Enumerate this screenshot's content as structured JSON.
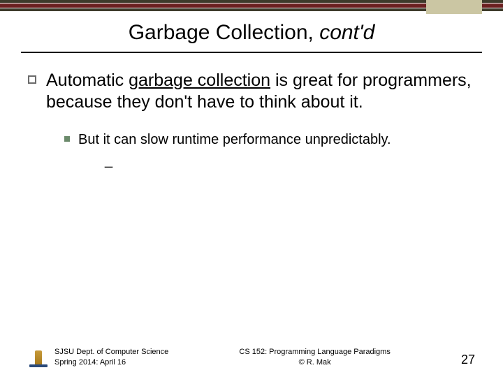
{
  "title_plain": "Garbage Collection, ",
  "title_italic": "cont'd",
  "body": {
    "point1_prefix": "Automatic ",
    "point1_underlined": "garbage collection",
    "point1_suffix": " is great for programmers, because they don't have to think about it.",
    "sub1": "But it can slow runtime performance unpredictably.",
    "sub1a": "_"
  },
  "footer": {
    "dept_line1": "SJSU Dept. of Computer Science",
    "dept_line2": "Spring 2014: April 16",
    "course_line1": "CS 152: Programming Language Paradigms",
    "course_line2": "© R. Mak",
    "page": "27"
  }
}
